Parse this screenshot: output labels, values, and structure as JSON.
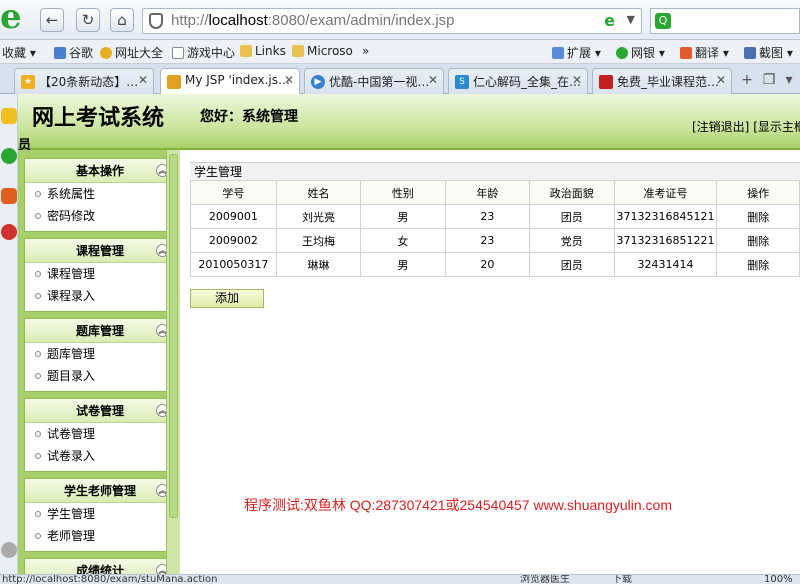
{
  "browser": {
    "url_scheme": "http://",
    "url_host": "localhost",
    "url_rest": ":8080/exam/admin/index.jsp",
    "bookmarks": [
      "收藏",
      "谷歌",
      "网址大全",
      "游戏中心",
      "Links",
      "Microso"
    ],
    "bookmarks_more": "»",
    "bookmarks_right": [
      "扩展",
      "网银",
      "翻译",
      "截图"
    ],
    "tabs": [
      {
        "label": "【20条新动态】…"
      },
      {
        "label": "My JSP 'index.js…"
      },
      {
        "label": "优酷-中国第一视…"
      },
      {
        "label": "仁心解码_全集_在…"
      },
      {
        "label": "免费_毕业课程范…"
      }
    ]
  },
  "header": {
    "title": "网上考试系统",
    "greeting": "您好：系统管理",
    "greeting_overflow": "员",
    "logout": "[注销退出]",
    "show_frame": "[显示主框架]"
  },
  "menu": [
    {
      "title": "基本操作",
      "items": [
        "系统属性",
        "密码修改"
      ]
    },
    {
      "title": "课程管理",
      "items": [
        "课程管理",
        "课程录入"
      ]
    },
    {
      "title": "题库管理",
      "items": [
        "题库管理",
        "题目录入"
      ]
    },
    {
      "title": "试卷管理",
      "items": [
        "试卷管理",
        "试卷录入"
      ]
    },
    {
      "title": "学生老师管理",
      "items": [
        "学生管理",
        "老师管理"
      ]
    },
    {
      "title": "成绩统计",
      "items": []
    }
  ],
  "main": {
    "panel_title": "学生管理",
    "columns": [
      "学号",
      "姓名",
      "性别",
      "年龄",
      "政治面貌",
      "准考证号",
      "操作"
    ],
    "rows": [
      [
        "2009001",
        "刘光亮",
        "男",
        "23",
        "团员",
        "37132316845121",
        "删除"
      ],
      [
        "2009002",
        "王均梅",
        "女",
        "23",
        "党员",
        "37132316851221",
        "删除"
      ],
      [
        "2010050317",
        "琳琳",
        "男",
        "20",
        "团员",
        "32431414",
        "删除"
      ]
    ],
    "add_label": "添加",
    "watermark": "程序测试:双鱼林 QQ:287307421或254540457 www.shuangyulin.com"
  },
  "status": {
    "url": "http://localhost:8080/exam/stuMana.action",
    "mode": "浏览器医生",
    "download": "下载",
    "zoom": "100%"
  },
  "colors": {
    "accent_green": "#a7cf6a",
    "watermark_red": "#e02020"
  }
}
